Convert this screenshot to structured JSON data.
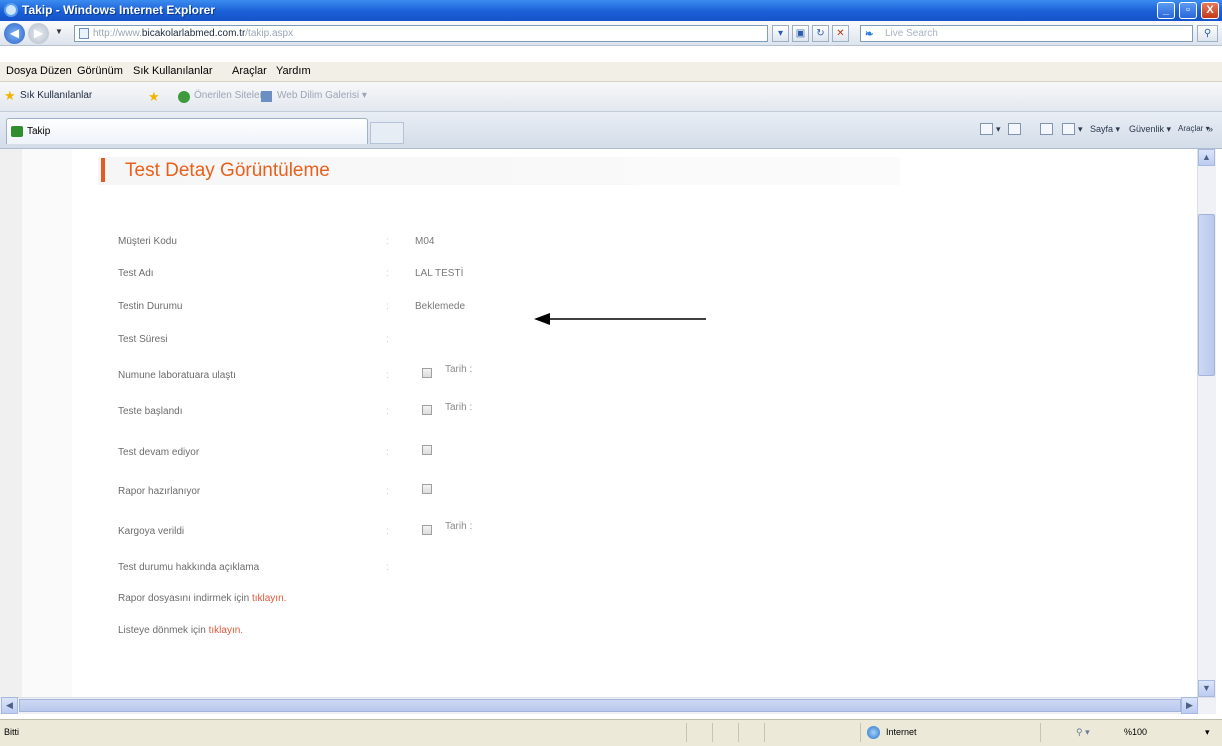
{
  "window": {
    "title": "Takip - Windows Internet Explorer",
    "min_label": "_",
    "max_label": "▫",
    "close_label": "X"
  },
  "address": {
    "url_prefix": "http://www.",
    "url_domain": "bicakolarlabmed.com.tr",
    "url_path": "/takip.aspx",
    "search_placeholder": "Live Search"
  },
  "menu": {
    "items": [
      "Dosya",
      "Düzen",
      "Görünüm",
      "Sık Kullanılanlar",
      "Araçlar",
      "Yardım"
    ]
  },
  "favorites": {
    "label": "Sık Kullanılanlar",
    "suggested_sites": "Önerilen Siteler ▾",
    "web_slice": "Web Dilim Galerisi ▾"
  },
  "tab": {
    "title": "Takip"
  },
  "commands": {
    "page": "Sayfa ▾",
    "safety": "Güvenlik ▾",
    "tools": "Araçlar ▾",
    "more": "»"
  },
  "page": {
    "heading": "Test Detay Görüntüleme",
    "fields": [
      {
        "label": "Müşteri Kodu",
        "sep": ":",
        "value": "M04"
      },
      {
        "label": "Test Adı",
        "sep": ":",
        "value": "LAL TESTİ"
      },
      {
        "label": "Testin Durumu",
        "sep": ":",
        "value": "Beklemede"
      },
      {
        "label": "Test Süresi",
        "sep": ":",
        "value": ""
      }
    ],
    "stages": [
      {
        "label": "Numune laboratuara ulaştı",
        "sep": ":",
        "date_label": "Tarih :"
      },
      {
        "label": "Teste başlandı",
        "sep": ":",
        "date_label": "Tarih :"
      },
      {
        "label": "Test devam ediyor",
        "sep": ":",
        "date_label": ""
      },
      {
        "label": "Rapor hazırlanıyor",
        "sep": ":",
        "date_label": ""
      },
      {
        "label": "Kargoya verildi",
        "sep": ":",
        "date_label": "Tarih :"
      }
    ],
    "note_label": "Test durumu hakkında açıklama",
    "note_sep": ":",
    "download_text": "Rapor dosyasını indirmek için",
    "download_link": "tıklayın.",
    "back_text": "Listeye dönmek için",
    "back_link": "tıklayın."
  },
  "status": {
    "left": "Bitti",
    "zone": "Internet",
    "zoom": "%100",
    "zoom_arrow": "▾"
  },
  "colors": {
    "heading": "#e8601c",
    "accent_bar": "#e55a20",
    "link": "#e2583a",
    "titlebar": "#1b5fd6"
  }
}
